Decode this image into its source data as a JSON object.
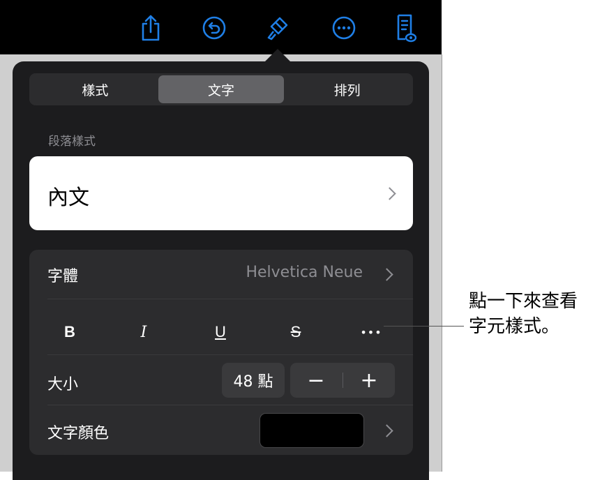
{
  "toolbar": {
    "icons": [
      "share-icon",
      "undo-icon",
      "format-brush-icon",
      "more-icon",
      "reading-view-icon"
    ],
    "accent_color": "#1f7fe6"
  },
  "inspector": {
    "tabs": [
      "樣式",
      "文字",
      "排列"
    ],
    "active_tab": "文字",
    "paragraph_section_label": "段落樣式",
    "paragraph_style": "內文",
    "font": {
      "label": "字體",
      "value": "Helvetica Neue"
    },
    "style_buttons": {
      "bold": "B",
      "italic": "I",
      "underline": "U",
      "strikethrough": "S",
      "more": "•••"
    },
    "size": {
      "label": "大小",
      "value": "48 點",
      "decrement": "−",
      "increment": "+"
    },
    "text_color": {
      "label": "文字顏色",
      "swatch_color": "#000000"
    }
  },
  "callout": {
    "line1": "點一下來查看",
    "line2": "字元樣式。"
  }
}
